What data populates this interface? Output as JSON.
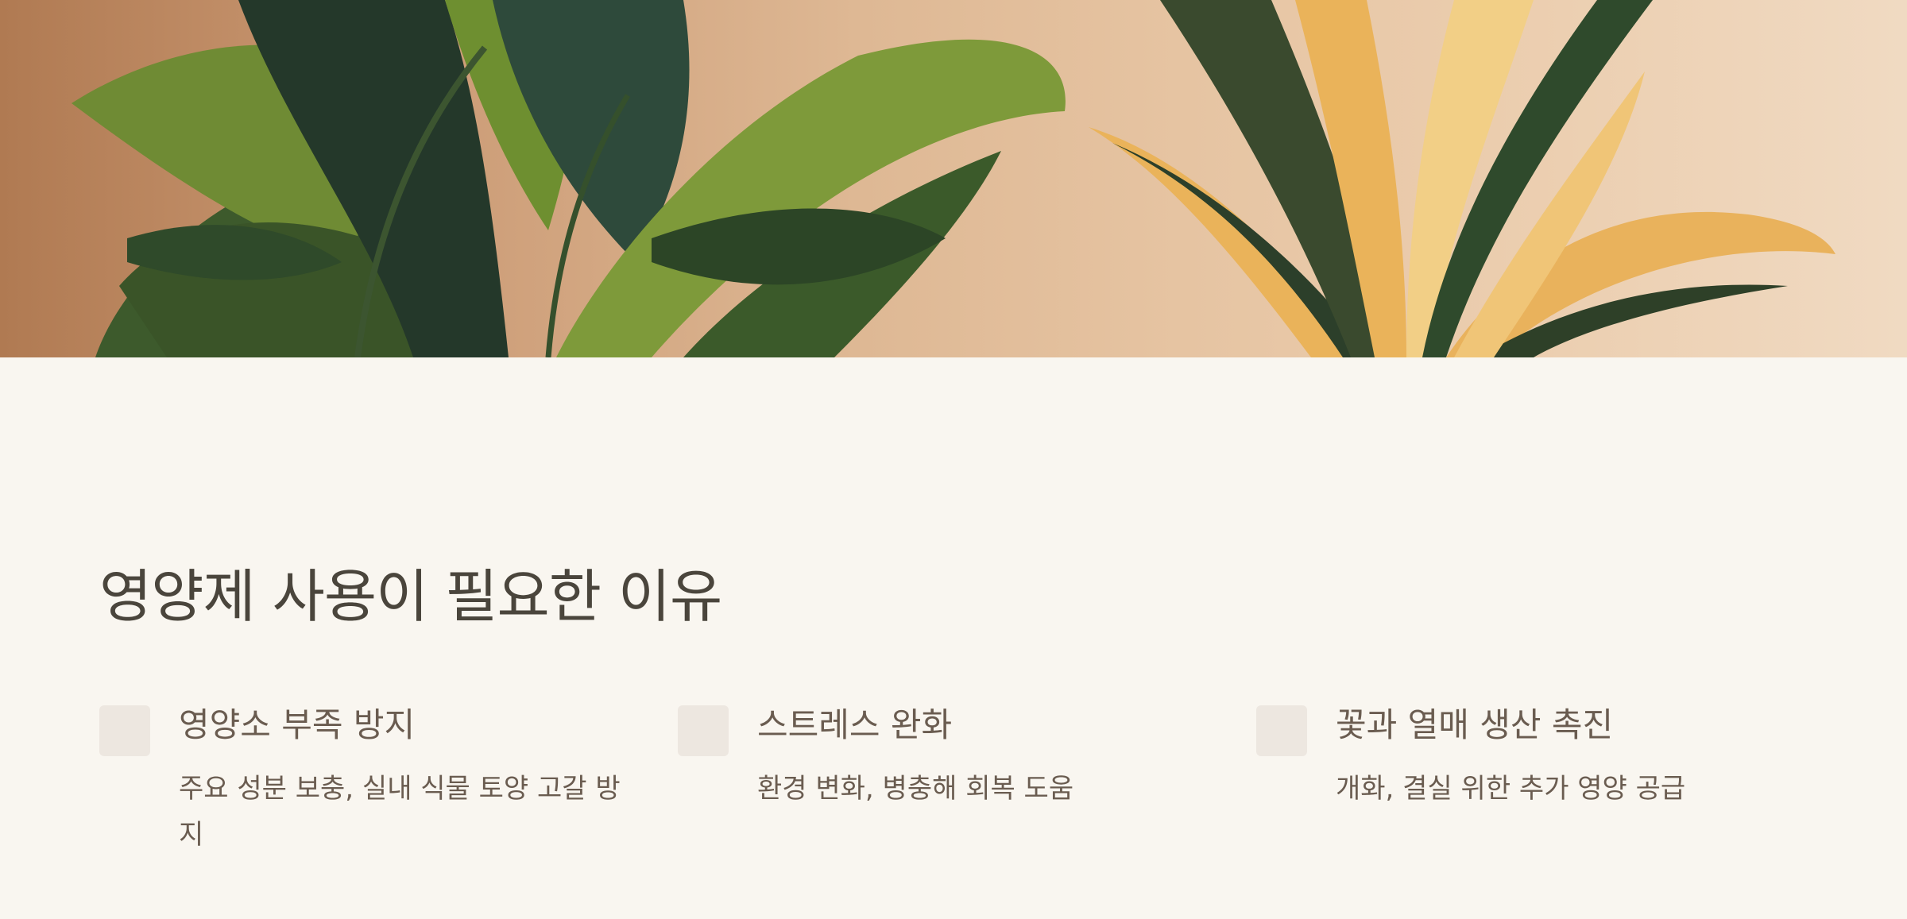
{
  "hero": {
    "image": "indoor-plants-photo",
    "colors": {
      "wall": "#deb894",
      "leaf_dark": "#2f4a2a",
      "leaf_light": "#7e9a3a",
      "leaf_yellow": "#eab35a"
    }
  },
  "section": {
    "title": "영양제 사용이 필요한 이유",
    "cards": [
      {
        "icon": "square-icon",
        "heading": "영양소 부족 방지",
        "description": "주요 성분 보충, 실내 식물 토양 고갈 방지"
      },
      {
        "icon": "square-icon",
        "heading": "스트레스 완화",
        "description": "환경 변화, 병충해 회복 도움"
      },
      {
        "icon": "square-icon",
        "heading": "꽃과 열매 생산 촉진",
        "description": "개화, 결실 위한 추가 영양 공급"
      }
    ]
  },
  "colors": {
    "background": "#f9f6f0",
    "title": "#4a453c",
    "text": "#6a5c50",
    "icon_box": "#ede7e0"
  }
}
